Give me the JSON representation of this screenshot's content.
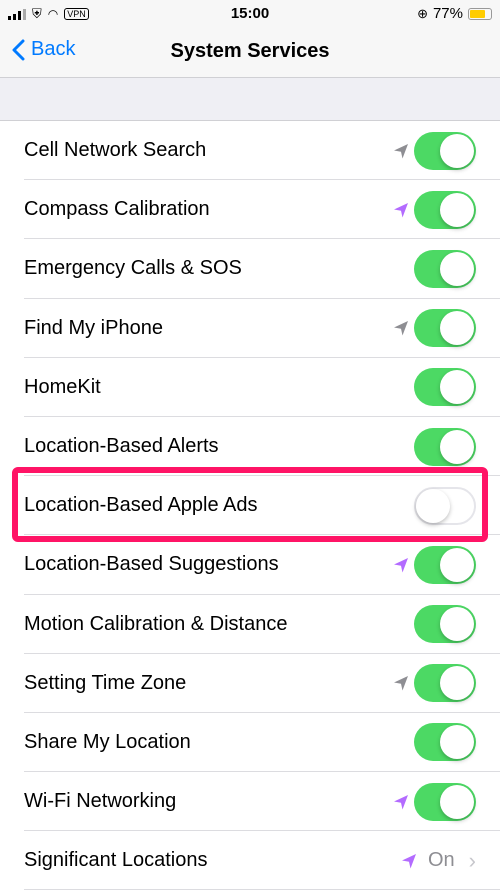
{
  "status": {
    "time": "15:00",
    "vpn": "VPN",
    "battery": "77%",
    "battery_level": 0.77
  },
  "nav": {
    "back": "Back",
    "title": "System Services"
  },
  "colors": {
    "accent": "#007aff",
    "toggle_on": "#4cd964",
    "highlight": "#ff1466",
    "arrow_purple": "#b36bff",
    "arrow_gray": "#8e8e93"
  },
  "rows": [
    {
      "label": "Cell Network Search",
      "arrow": "gray",
      "on": true
    },
    {
      "label": "Compass Calibration",
      "arrow": "purple",
      "on": true
    },
    {
      "label": "Emergency Calls & SOS",
      "arrow": null,
      "on": true
    },
    {
      "label": "Find My iPhone",
      "arrow": "gray",
      "on": true
    },
    {
      "label": "HomeKit",
      "arrow": null,
      "on": true
    },
    {
      "label": "Location-Based Alerts",
      "arrow": null,
      "on": true
    },
    {
      "label": "Location-Based Apple Ads",
      "arrow": null,
      "on": false
    },
    {
      "label": "Location-Based Suggestions",
      "arrow": "purple",
      "on": true
    },
    {
      "label": "Motion Calibration & Distance",
      "arrow": null,
      "on": true
    },
    {
      "label": "Setting Time Zone",
      "arrow": "gray",
      "on": true
    },
    {
      "label": "Share My Location",
      "arrow": null,
      "on": true
    },
    {
      "label": "Wi-Fi Networking",
      "arrow": "purple",
      "on": true
    }
  ],
  "last_row": {
    "label": "Significant Locations",
    "value": "On",
    "arrow": "purple"
  }
}
